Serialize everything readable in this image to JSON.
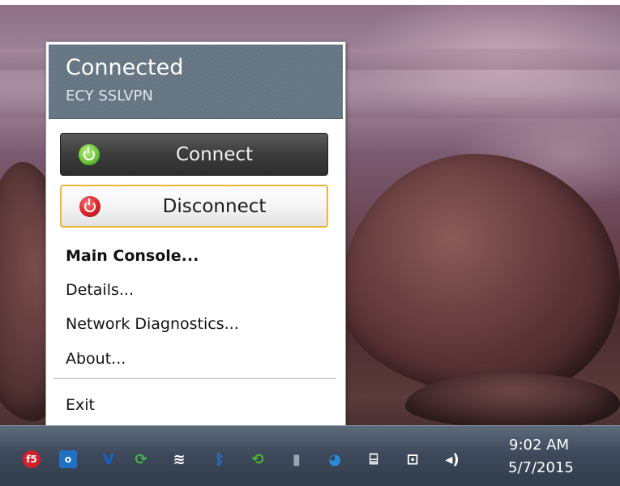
{
  "popup": {
    "status": "Connected",
    "profile": "ECY SSLVPN",
    "connect_label": "Connect",
    "disconnect_label": "Disconnect",
    "menu": [
      {
        "label": "Main Console...",
        "bold": true
      },
      {
        "label": "Details..."
      },
      {
        "label": "Network Diagnostics..."
      },
      {
        "label": "About..."
      }
    ],
    "exit_label": "Exit"
  },
  "taskbar": {
    "tray_icons": [
      {
        "name": "f5-icon",
        "glyph": "f5",
        "color": "#d3202f"
      },
      {
        "name": "outlook-icon",
        "glyph": "o",
        "color": "#1f6fc5"
      },
      {
        "name": "v-icon",
        "glyph": "V",
        "color": "#1a5fd0"
      },
      {
        "name": "sync-icon",
        "glyph": "⟳",
        "color": "#40b84a"
      },
      {
        "name": "wifi-icon",
        "glyph": "≋",
        "color": "#ffffff"
      },
      {
        "name": "bluetooth-icon",
        "glyph": "ᛒ",
        "color": "#2a6fd0"
      },
      {
        "name": "refresh-icon",
        "glyph": "⟲",
        "color": "#4ab82c"
      },
      {
        "name": "usb-icon",
        "glyph": "▮",
        "color": "#9aa6b3"
      },
      {
        "name": "globe-icon",
        "glyph": "◕",
        "color": "#2b8ad8"
      },
      {
        "name": "power-plug-icon",
        "glyph": "⌸",
        "color": "#ffffff"
      },
      {
        "name": "network-icon",
        "glyph": "⊡",
        "color": "#ffffff"
      },
      {
        "name": "volume-icon",
        "glyph": "◂)",
        "color": "#ffffff"
      }
    ],
    "time": "9:02 AM",
    "date": "5/7/2015"
  }
}
